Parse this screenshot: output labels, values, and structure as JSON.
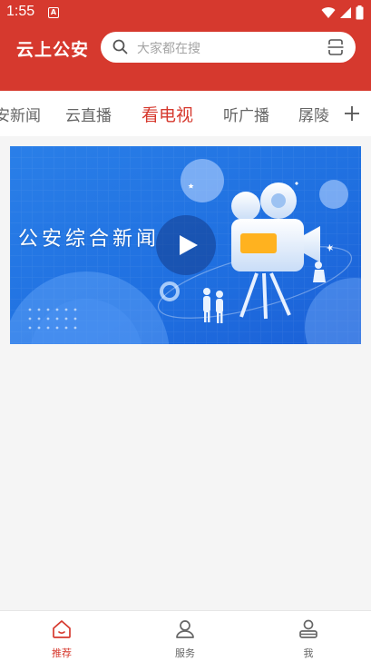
{
  "status_bar": {
    "time": "1:55",
    "notification_badge": "A"
  },
  "header": {
    "title": "云上公安",
    "search_placeholder": "大家都在搜"
  },
  "channels": [
    {
      "label": "安新闻"
    },
    {
      "label": "云直播"
    },
    {
      "label": "看电视",
      "active": true
    },
    {
      "label": "听广播"
    },
    {
      "label": "孱陵"
    }
  ],
  "video": {
    "title": "公安综合新闻"
  },
  "tabbar": [
    {
      "label": "推荐",
      "icon": "home-icon",
      "active": true
    },
    {
      "label": "服务",
      "icon": "person-icon"
    },
    {
      "label": "我",
      "icon": "profile-icon"
    }
  ],
  "colors": {
    "brand": "#d6392e",
    "inactive": "#666666"
  }
}
